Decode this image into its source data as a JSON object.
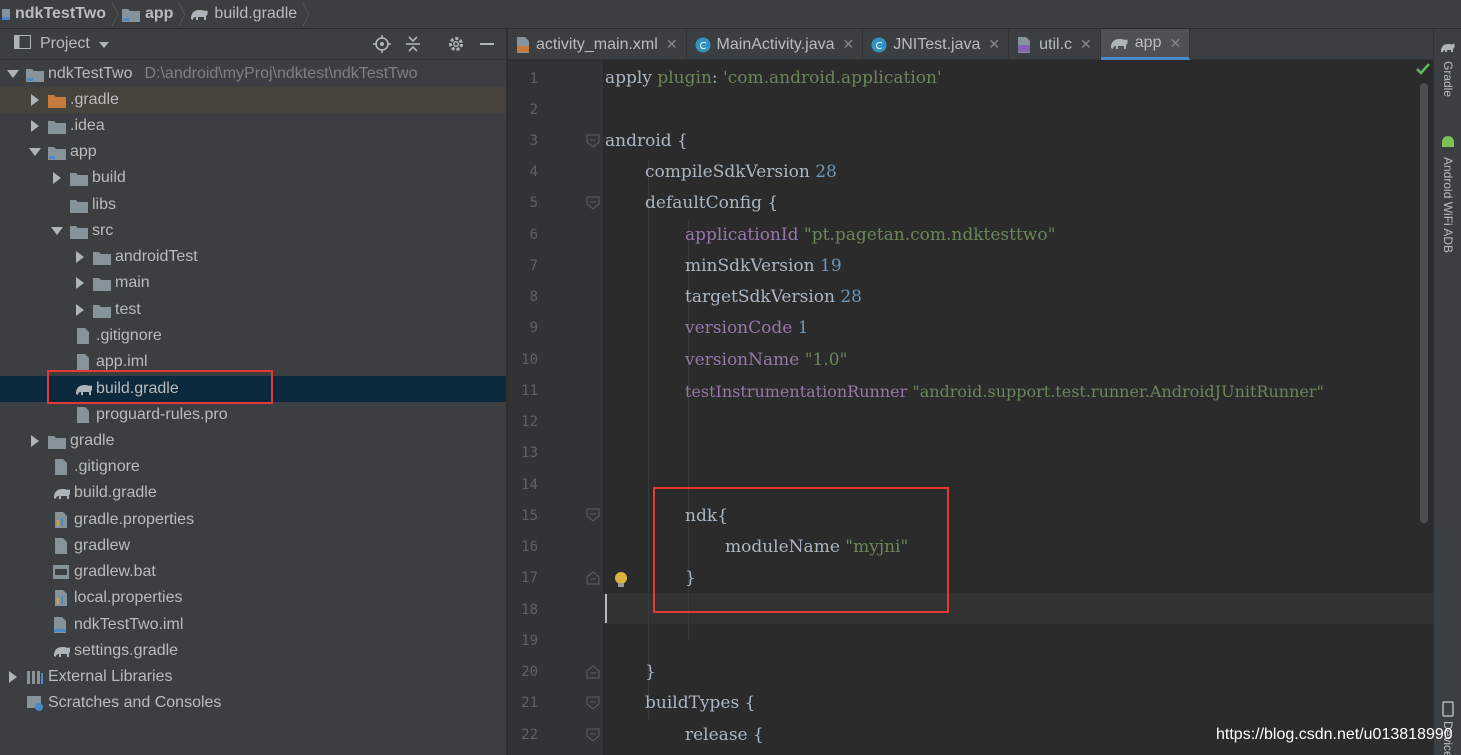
{
  "breadcrumb": {
    "items": [
      {
        "label": "ndkTestTwo"
      },
      {
        "label": "app"
      },
      {
        "label": "build.gradle"
      }
    ]
  },
  "project_panel": {
    "title": "Project",
    "tree": [
      {
        "label": "ndkTestTwo",
        "path": "D:\\android\\myProj\\ndktest\\ndkTestTwo"
      },
      {
        "label": ".gradle"
      },
      {
        "label": ".idea"
      },
      {
        "label": "app"
      },
      {
        "label": "build"
      },
      {
        "label": "libs"
      },
      {
        "label": "src"
      },
      {
        "label": "androidTest"
      },
      {
        "label": "main"
      },
      {
        "label": "test"
      },
      {
        "label": ".gitignore"
      },
      {
        "label": "app.iml"
      },
      {
        "label": "build.gradle"
      },
      {
        "label": "proguard-rules.pro"
      },
      {
        "label": "gradle"
      },
      {
        "label": ".gitignore"
      },
      {
        "label": "build.gradle"
      },
      {
        "label": "gradle.properties"
      },
      {
        "label": "gradlew"
      },
      {
        "label": "gradlew.bat"
      },
      {
        "label": "local.properties"
      },
      {
        "label": "ndkTestTwo.iml"
      },
      {
        "label": "settings.gradle"
      },
      {
        "label": "External Libraries"
      },
      {
        "label": "Scratches and Consoles"
      }
    ]
  },
  "tabs": [
    {
      "label": "activity_main.xml"
    },
    {
      "label": "MainActivity.java"
    },
    {
      "label": "JNITest.java"
    },
    {
      "label": "util.c"
    },
    {
      "label": "app"
    }
  ],
  "editor": {
    "line_numbers": [
      "1",
      "2",
      "3",
      "4",
      "5",
      "6",
      "7",
      "8",
      "9",
      "10",
      "11",
      "12",
      "13",
      "14",
      "15",
      "16",
      "17",
      "18",
      "19",
      "20",
      "21",
      "22"
    ],
    "code": {
      "l1a": "apply ",
      "l1b": "plugin",
      "l1c": ": ",
      "l1d": "'com.android.application'",
      "l3": "android {",
      "l4a": "compileSdkVersion ",
      "l4b": "28",
      "l5": "defaultConfig {",
      "l6a": "applicationId ",
      "l6b": "\"pt.pagetan.com.ndktesttwo\"",
      "l7a": "minSdkVersion ",
      "l7b": "19",
      "l8a": "targetSdkVersion ",
      "l8b": "28",
      "l9a": "versionCode ",
      "l9b": "1",
      "l10a": "versionName ",
      "l10b": "\"1.0\"",
      "l11a": "testInstrumentationRunner ",
      "l11b": "\"android.support.test.runner.AndroidJUnitRunner\"",
      "l15": "ndk{",
      "l16a": "moduleName ",
      "l16b": "\"myjni\"",
      "l17": "}",
      "l20": "}",
      "l21": "buildTypes {",
      "l22": "release {"
    }
  },
  "right_strip": {
    "gradle": "Gradle",
    "wifi_adb": "Android WiFi ADB",
    "device": "Device"
  },
  "watermark": "https://blog.csdn.net/u013818990",
  "colors": {
    "accent": "#4a88c7",
    "highlight_box": "#e53935",
    "string": "#6a8759",
    "number": "#6897bb",
    "property": "#9876aa"
  }
}
